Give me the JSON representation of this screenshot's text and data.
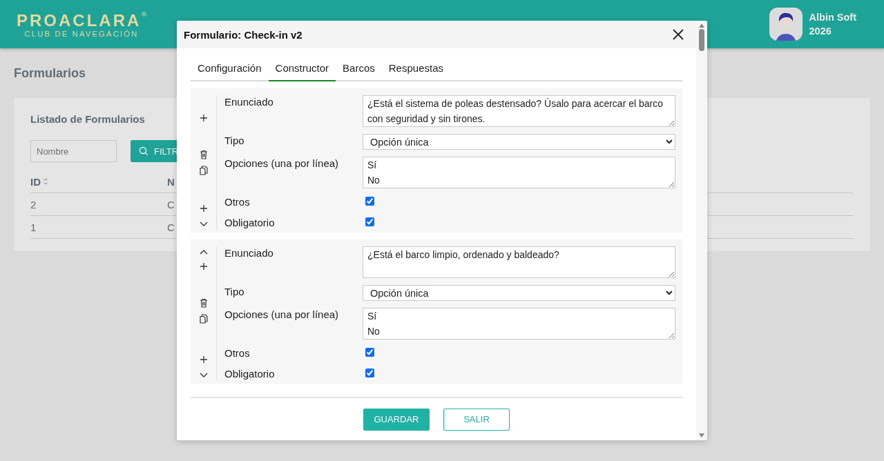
{
  "header": {
    "logo": {
      "name": "PROACLARA",
      "mark": "®",
      "subtitle": "CLUB DE NAVEGACIÓN"
    },
    "user": {
      "name": "Albin Soft",
      "year": "2026"
    }
  },
  "page": {
    "title": "Formularios",
    "card": {
      "title": "Listado de Formularios",
      "filter": {
        "placeholder": "Nombre"
      },
      "filter_button": "FILTR",
      "columns": [
        "ID",
        "N"
      ],
      "rows": [
        [
          "2",
          "C"
        ],
        [
          "1",
          "C"
        ]
      ]
    }
  },
  "dialog": {
    "title": "Formulario: Check-in v2",
    "tabs": [
      {
        "label": "Configuración",
        "selected": false
      },
      {
        "label": "Constructor",
        "selected": true
      },
      {
        "label": "Barcos",
        "selected": false
      },
      {
        "label": "Respuestas",
        "selected": false
      }
    ],
    "questions": [
      {
        "labels": {
          "statement": "Enunciado",
          "type": "Tipo",
          "options": "Opciones (una por línea)",
          "other": "Otros",
          "required": "Obligatorio"
        },
        "statement": "¿Está el sistema de poleas destensado? Úsalo para acercar el barco con seguridad y sin tirones.",
        "type": "Opción única",
        "options": [
          "Sí",
          "No"
        ],
        "other": true,
        "required": true
      },
      {
        "labels": {
          "statement": "Enunciado",
          "type": "Tipo",
          "options": "Opciones (una por línea)",
          "other": "Otros",
          "required": "Obligatorio"
        },
        "statement": "¿Está el barco limpio, ordenado y baldeado?",
        "type": "Opción única",
        "options": [
          "Sí",
          "No"
        ],
        "other": true,
        "required": true
      }
    ],
    "buttons": {
      "save": "GUARDAR",
      "exit": "SALIR"
    }
  }
}
